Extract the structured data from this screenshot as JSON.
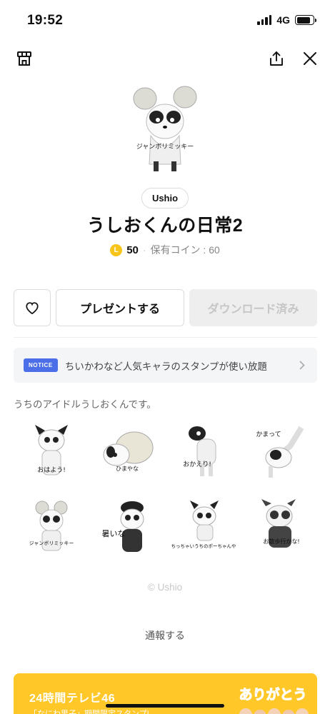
{
  "status_bar": {
    "time": "19:52",
    "network": "4G"
  },
  "nav": {
    "shop_icon": "shop-icon",
    "share_icon": "share-icon",
    "close_icon": "close-icon"
  },
  "hero": {
    "caption": "ジャンボリミッキー"
  },
  "product": {
    "author": "Ushio",
    "title": "うしおくんの日常2",
    "coin_letter": "L",
    "price": "50",
    "separator": "·",
    "owned_coins": "保有コイン : 60"
  },
  "actions": {
    "present": "プレゼントする",
    "download": "ダウンロード済み"
  },
  "notice": {
    "badge": "NOTICE",
    "text": "ちいかわなど人気キャラのスタンプが使い放題"
  },
  "description": "うちのアイドルうしおくんです。",
  "stickers": [
    {
      "caption": "おはよう!"
    },
    {
      "caption": "ひまやな"
    },
    {
      "caption": "おかえり!"
    },
    {
      "caption": "かまって"
    },
    {
      "caption": "ジャンボリミッキー"
    },
    {
      "caption": "暑いな"
    },
    {
      "caption": "ちっちゃいうちのポーちゃんや"
    },
    {
      "caption": "お散歩行かな!"
    }
  ],
  "footer": {
    "copyright": "© Ushio",
    "report": "通報する"
  },
  "banner": {
    "title": "24時間テレビ46",
    "subtitle": "「なにわ男子」期間限定スタンプ!",
    "art_text": "ありがとう"
  },
  "colors": {
    "coin": "#f7c51a",
    "notice_badge": "#4c6ee8",
    "banner": "#ffc728"
  }
}
